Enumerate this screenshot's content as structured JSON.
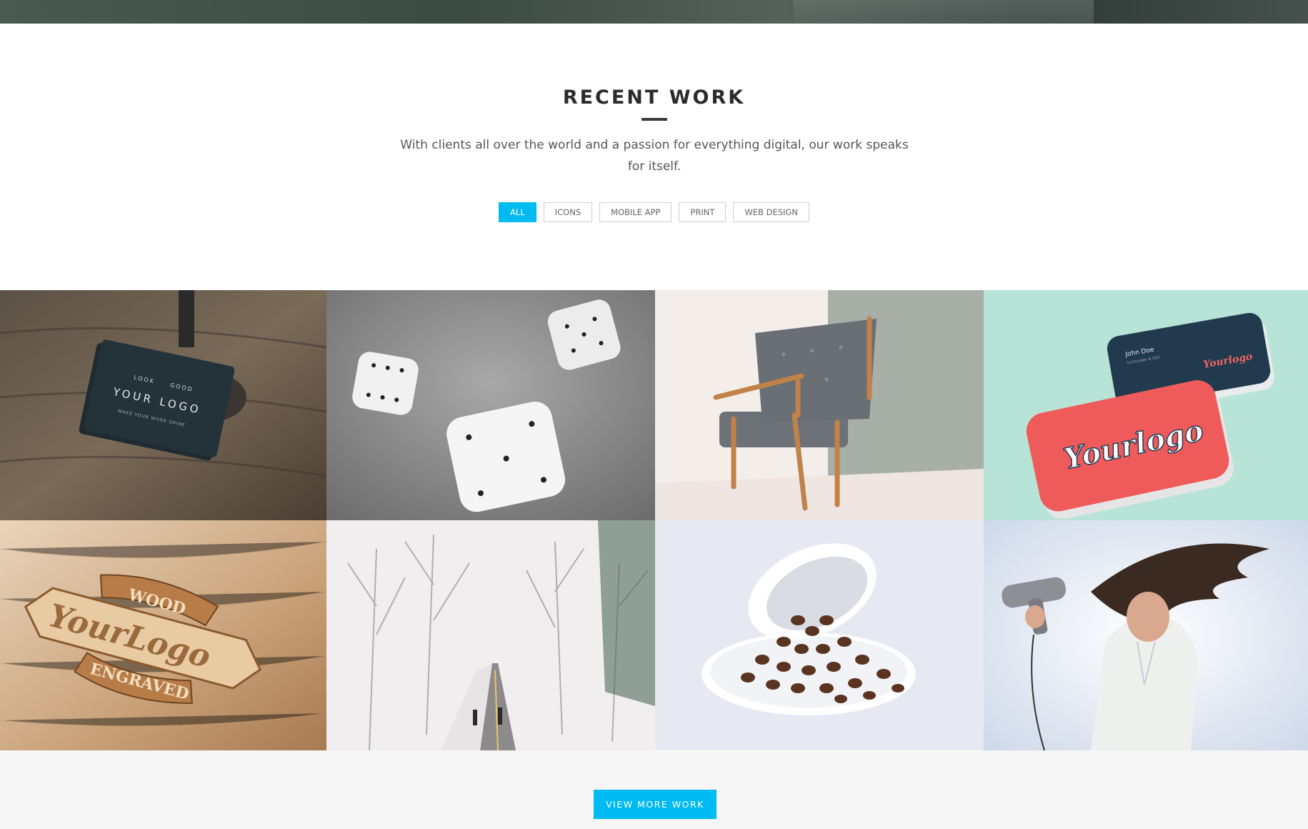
{
  "section": {
    "title": "RECENT WORK",
    "subtitle": "With clients all over the world and a passion for everything digital, our work speaks for itself."
  },
  "filters": [
    {
      "label": "ALL",
      "active": true
    },
    {
      "label": "ICONS",
      "active": false
    },
    {
      "label": "MOBILE APP",
      "active": false
    },
    {
      "label": "PRINT",
      "active": false
    },
    {
      "label": "WEB DESIGN",
      "active": false
    }
  ],
  "portfolio": {
    "tiles": [
      {
        "subject": "business-cards-wood",
        "logo_lines": [
          "LOOK",
          "GOOD",
          "YOUR LOGO",
          "MAKE YOUR WORK SHINE"
        ]
      },
      {
        "subject": "white-dice"
      },
      {
        "subject": "armchair"
      },
      {
        "subject": "business-cards-mint",
        "logo_text": "Yourlogo",
        "card_name": "John Doe",
        "card_role": "Co-Founder & CEO"
      },
      {
        "subject": "wood-engraved-logo",
        "logo_lines": [
          "WOOD",
          "YourLogo",
          "ENGRAVED"
        ]
      },
      {
        "subject": "snowy-road"
      },
      {
        "subject": "coffee-beans-cup"
      },
      {
        "subject": "hairdryer-woman"
      }
    ]
  },
  "cta": {
    "label": "VIEW MORE WORK"
  },
  "colors": {
    "accent": "#00baf2",
    "footer_bg": "#f6f6f6"
  }
}
